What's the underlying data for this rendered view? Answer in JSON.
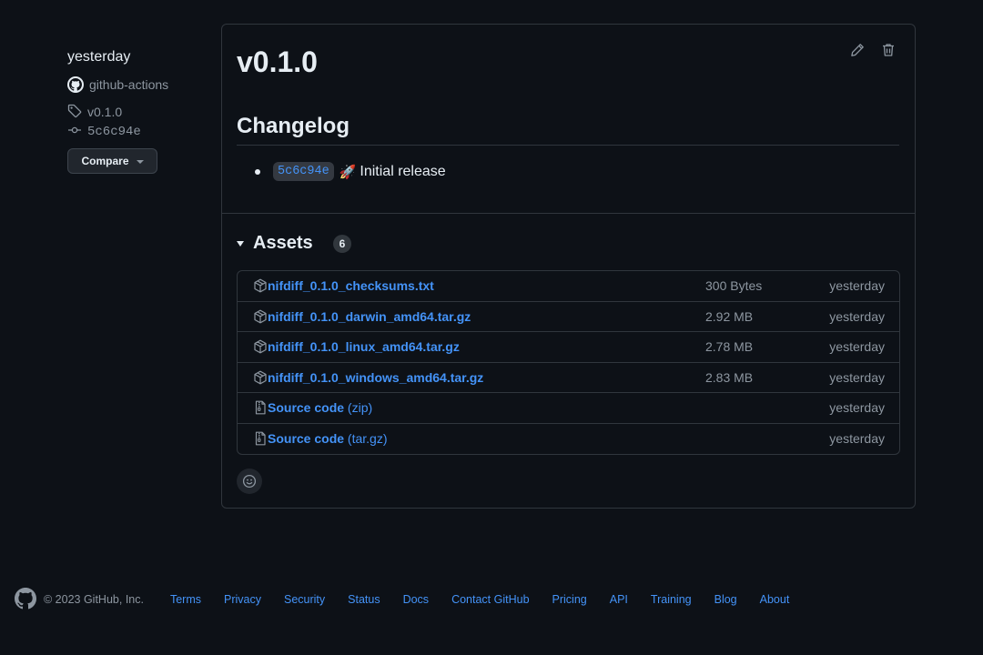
{
  "sidebar": {
    "date": "yesterday",
    "author": "github-actions",
    "tag": "v0.1.0",
    "commit": "5c6c94e",
    "compare_label": "Compare"
  },
  "release": {
    "title": "v0.1.0",
    "changelog_heading": "Changelog",
    "changelog_items": [
      {
        "sha": "5c6c94e",
        "emoji": "🚀",
        "text": "Initial release"
      }
    ]
  },
  "assets": {
    "heading": "Assets",
    "count": "6",
    "items": [
      {
        "name": "nifdiff_0.1.0_checksums.txt",
        "suffix": "",
        "size": "300 Bytes",
        "date": "yesterday",
        "icon": "package-icon"
      },
      {
        "name": "nifdiff_0.1.0_darwin_amd64.tar.gz",
        "suffix": "",
        "size": "2.92 MB",
        "date": "yesterday",
        "icon": "package-icon"
      },
      {
        "name": "nifdiff_0.1.0_linux_amd64.tar.gz",
        "suffix": "",
        "size": "2.78 MB",
        "date": "yesterday",
        "icon": "package-icon"
      },
      {
        "name": "nifdiff_0.1.0_windows_amd64.tar.gz",
        "suffix": "",
        "size": "2.83 MB",
        "date": "yesterday",
        "icon": "package-icon"
      },
      {
        "name": "Source code",
        "suffix": " (zip)",
        "size": "",
        "date": "yesterday",
        "icon": "file-zip-icon"
      },
      {
        "name": "Source code",
        "suffix": " (tar.gz)",
        "size": "",
        "date": "yesterday",
        "icon": "file-zip-icon"
      }
    ]
  },
  "footer": {
    "copyright": "© 2023 GitHub, Inc.",
    "links": [
      "Terms",
      "Privacy",
      "Security",
      "Status",
      "Docs",
      "Contact GitHub",
      "Pricing",
      "API",
      "Training",
      "Blog",
      "About"
    ]
  },
  "colors": {
    "background": "#0d1117",
    "border": "#30363d",
    "link": "#4493f8",
    "muted": "#8d96a0",
    "text": "#e6edf3"
  }
}
